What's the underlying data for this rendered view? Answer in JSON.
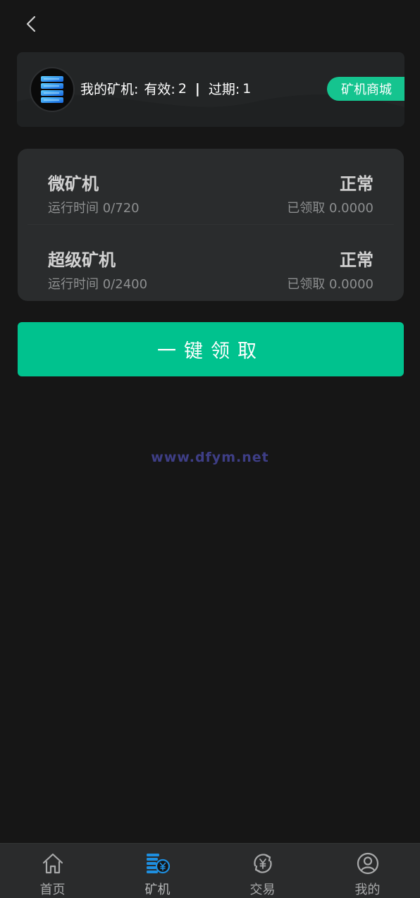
{
  "header": {
    "back_icon": "chevron-left-icon"
  },
  "summary": {
    "avatar_icon": "server-stack-icon",
    "label": "我的矿机:",
    "valid_label": "有效:",
    "valid_count": "2",
    "separator": "|",
    "expired_label": "过期:",
    "expired_count": "1",
    "shop_button": "矿机商城"
  },
  "machines": [
    {
      "name": "微矿机",
      "status": "正常",
      "runtime": "运行时间 0/720",
      "claimed": "已领取 0.0000"
    },
    {
      "name": "超级矿机",
      "status": "正常",
      "runtime": "运行时间 0/2400",
      "claimed": "已领取 0.0000"
    }
  ],
  "claim_button": "一键领取",
  "watermark": "www.dfym.net",
  "tabbar": {
    "items": [
      {
        "label": "首页",
        "icon": "home-icon",
        "active": false
      },
      {
        "label": "矿机",
        "icon": "miner-coin-icon",
        "active": true
      },
      {
        "label": "交易",
        "icon": "exchange-yuan-icon",
        "active": false
      },
      {
        "label": "我的",
        "icon": "user-icon",
        "active": false
      }
    ]
  },
  "colors": {
    "background": "#161616",
    "card": "#2a2c2d",
    "accent": "#00c28e",
    "watermark": "#3e3e86",
    "active_tab_icon": "#1e8fe0"
  }
}
